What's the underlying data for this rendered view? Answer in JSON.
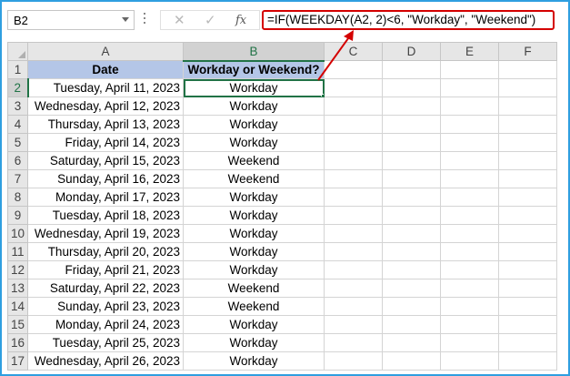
{
  "name_box": {
    "value": "B2"
  },
  "formula_bar": {
    "cancel_icon": "close-icon",
    "enter_icon": "check-icon",
    "function_label": "fx",
    "formula": "=IF(WEEKDAY(A2, 2)<6, \"Workday\", \"Weekend\")"
  },
  "columns": [
    "A",
    "B",
    "C",
    "D",
    "E",
    "F"
  ],
  "selected_column": "B",
  "header_row": {
    "row_number": "1",
    "date": "Date",
    "type": "Workday or Weekend?"
  },
  "rows": [
    {
      "row_number": "2",
      "date": "Tuesday, April 11, 2023",
      "type": "Workday"
    },
    {
      "row_number": "3",
      "date": "Wednesday, April 12, 2023",
      "type": "Workday"
    },
    {
      "row_number": "4",
      "date": "Thursday, April 13, 2023",
      "type": "Workday"
    },
    {
      "row_number": "5",
      "date": "Friday, April 14, 2023",
      "type": "Workday"
    },
    {
      "row_number": "6",
      "date": "Saturday, April 15, 2023",
      "type": "Weekend"
    },
    {
      "row_number": "7",
      "date": "Sunday, April 16, 2023",
      "type": "Weekend"
    },
    {
      "row_number": "8",
      "date": "Monday, April 17, 2023",
      "type": "Workday"
    },
    {
      "row_number": "9",
      "date": "Tuesday, April 18, 2023",
      "type": "Workday"
    },
    {
      "row_number": "10",
      "date": "Wednesday, April 19, 2023",
      "type": "Workday"
    },
    {
      "row_number": "11",
      "date": "Thursday, April 20, 2023",
      "type": "Workday"
    },
    {
      "row_number": "12",
      "date": "Friday, April 21, 2023",
      "type": "Workday"
    },
    {
      "row_number": "13",
      "date": "Saturday, April 22, 2023",
      "type": "Weekend"
    },
    {
      "row_number": "14",
      "date": "Sunday, April 23, 2023",
      "type": "Weekend"
    },
    {
      "row_number": "15",
      "date": "Monday, April 24, 2023",
      "type": "Workday"
    },
    {
      "row_number": "16",
      "date": "Tuesday, April 25, 2023",
      "type": "Workday"
    },
    {
      "row_number": "17",
      "date": "Wednesday, April 26, 2023",
      "type": "Workday"
    }
  ],
  "colors": {
    "header_fill": "#b4c6e7",
    "selection": "#217346",
    "annotation": "#d40000",
    "frame": "#2f9fe0"
  }
}
